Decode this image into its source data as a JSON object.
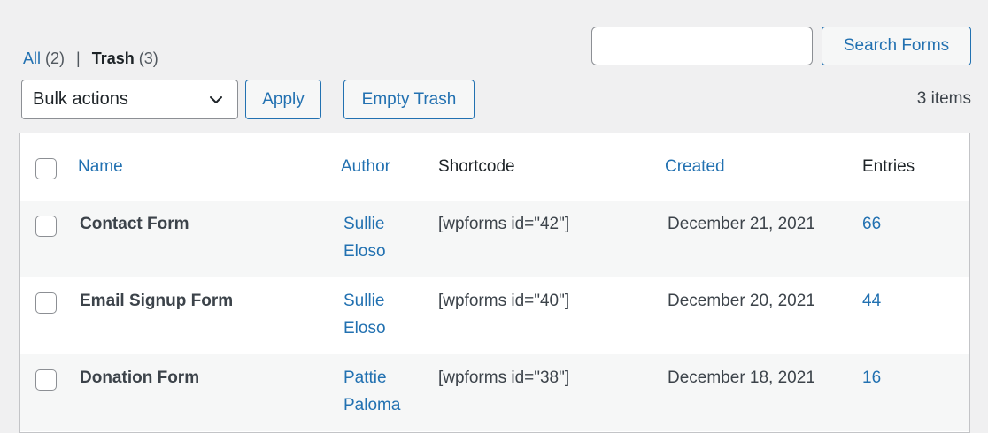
{
  "views": {
    "all_label": "All",
    "all_count": "(2)",
    "separator": "|",
    "trash_label": "Trash",
    "trash_count": "(3)"
  },
  "search": {
    "value": "",
    "button_label": "Search Forms"
  },
  "bulk": {
    "selected": "Bulk actions",
    "apply_label": "Apply",
    "empty_trash_label": "Empty Trash"
  },
  "items_count": "3 items",
  "table": {
    "columns": {
      "name": "Name",
      "author": "Author",
      "shortcode": "Shortcode",
      "created": "Created",
      "entries": "Entries"
    },
    "rows": [
      {
        "name": "Contact Form",
        "author_line1": "Sullie",
        "author_line2": "Eloso",
        "shortcode": "[wpforms id=\"42\"]",
        "created": "December 21, 2021",
        "entries": "66"
      },
      {
        "name": "Email Signup Form",
        "author_line1": "Sullie",
        "author_line2": "Eloso",
        "shortcode": "[wpforms id=\"40\"]",
        "created": "December 20, 2021",
        "entries": "44"
      },
      {
        "name": "Donation Form",
        "author_line1": "Pattie",
        "author_line2": "Paloma",
        "shortcode": "[wpforms id=\"38\"]",
        "created": "December 18, 2021",
        "entries": "16"
      }
    ]
  },
  "colors": {
    "link": "#2271b1",
    "background": "#f0f0f1",
    "row_alt": "#f6f7f7",
    "border": "#c3c4c7"
  },
  "icons": {
    "select_arrow": "chevron-down-icon"
  }
}
